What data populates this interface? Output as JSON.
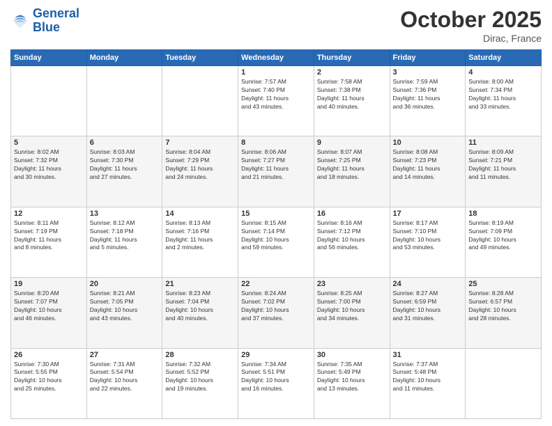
{
  "logo": {
    "line1": "General",
    "line2": "Blue"
  },
  "header": {
    "title": "October 2025",
    "location": "Dirac, France"
  },
  "days_of_week": [
    "Sunday",
    "Monday",
    "Tuesday",
    "Wednesday",
    "Thursday",
    "Friday",
    "Saturday"
  ],
  "weeks": [
    [
      {
        "day": "",
        "info": ""
      },
      {
        "day": "",
        "info": ""
      },
      {
        "day": "",
        "info": ""
      },
      {
        "day": "1",
        "info": "Sunrise: 7:57 AM\nSunset: 7:40 PM\nDaylight: 11 hours\nand 43 minutes."
      },
      {
        "day": "2",
        "info": "Sunrise: 7:58 AM\nSunset: 7:38 PM\nDaylight: 11 hours\nand 40 minutes."
      },
      {
        "day": "3",
        "info": "Sunrise: 7:59 AM\nSunset: 7:36 PM\nDaylight: 11 hours\nand 36 minutes."
      },
      {
        "day": "4",
        "info": "Sunrise: 8:00 AM\nSunset: 7:34 PM\nDaylight: 11 hours\nand 33 minutes."
      }
    ],
    [
      {
        "day": "5",
        "info": "Sunrise: 8:02 AM\nSunset: 7:32 PM\nDaylight: 11 hours\nand 30 minutes."
      },
      {
        "day": "6",
        "info": "Sunrise: 8:03 AM\nSunset: 7:30 PM\nDaylight: 11 hours\nand 27 minutes."
      },
      {
        "day": "7",
        "info": "Sunrise: 8:04 AM\nSunset: 7:29 PM\nDaylight: 11 hours\nand 24 minutes."
      },
      {
        "day": "8",
        "info": "Sunrise: 8:06 AM\nSunset: 7:27 PM\nDaylight: 11 hours\nand 21 minutes."
      },
      {
        "day": "9",
        "info": "Sunrise: 8:07 AM\nSunset: 7:25 PM\nDaylight: 11 hours\nand 18 minutes."
      },
      {
        "day": "10",
        "info": "Sunrise: 8:08 AM\nSunset: 7:23 PM\nDaylight: 11 hours\nand 14 minutes."
      },
      {
        "day": "11",
        "info": "Sunrise: 8:09 AM\nSunset: 7:21 PM\nDaylight: 11 hours\nand 11 minutes."
      }
    ],
    [
      {
        "day": "12",
        "info": "Sunrise: 8:11 AM\nSunset: 7:19 PM\nDaylight: 11 hours\nand 8 minutes."
      },
      {
        "day": "13",
        "info": "Sunrise: 8:12 AM\nSunset: 7:18 PM\nDaylight: 11 hours\nand 5 minutes."
      },
      {
        "day": "14",
        "info": "Sunrise: 8:13 AM\nSunset: 7:16 PM\nDaylight: 11 hours\nand 2 minutes."
      },
      {
        "day": "15",
        "info": "Sunrise: 8:15 AM\nSunset: 7:14 PM\nDaylight: 10 hours\nand 59 minutes."
      },
      {
        "day": "16",
        "info": "Sunrise: 8:16 AM\nSunset: 7:12 PM\nDaylight: 10 hours\nand 56 minutes."
      },
      {
        "day": "17",
        "info": "Sunrise: 8:17 AM\nSunset: 7:10 PM\nDaylight: 10 hours\nand 53 minutes."
      },
      {
        "day": "18",
        "info": "Sunrise: 8:19 AM\nSunset: 7:09 PM\nDaylight: 10 hours\nand 49 minutes."
      }
    ],
    [
      {
        "day": "19",
        "info": "Sunrise: 8:20 AM\nSunset: 7:07 PM\nDaylight: 10 hours\nand 46 minutes."
      },
      {
        "day": "20",
        "info": "Sunrise: 8:21 AM\nSunset: 7:05 PM\nDaylight: 10 hours\nand 43 minutes."
      },
      {
        "day": "21",
        "info": "Sunrise: 8:23 AM\nSunset: 7:04 PM\nDaylight: 10 hours\nand 40 minutes."
      },
      {
        "day": "22",
        "info": "Sunrise: 8:24 AM\nSunset: 7:02 PM\nDaylight: 10 hours\nand 37 minutes."
      },
      {
        "day": "23",
        "info": "Sunrise: 8:25 AM\nSunset: 7:00 PM\nDaylight: 10 hours\nand 34 minutes."
      },
      {
        "day": "24",
        "info": "Sunrise: 8:27 AM\nSunset: 6:59 PM\nDaylight: 10 hours\nand 31 minutes."
      },
      {
        "day": "25",
        "info": "Sunrise: 8:28 AM\nSunset: 6:57 PM\nDaylight: 10 hours\nand 28 minutes."
      }
    ],
    [
      {
        "day": "26",
        "info": "Sunrise: 7:30 AM\nSunset: 5:55 PM\nDaylight: 10 hours\nand 25 minutes."
      },
      {
        "day": "27",
        "info": "Sunrise: 7:31 AM\nSunset: 5:54 PM\nDaylight: 10 hours\nand 22 minutes."
      },
      {
        "day": "28",
        "info": "Sunrise: 7:32 AM\nSunset: 5:52 PM\nDaylight: 10 hours\nand 19 minutes."
      },
      {
        "day": "29",
        "info": "Sunrise: 7:34 AM\nSunset: 5:51 PM\nDaylight: 10 hours\nand 16 minutes."
      },
      {
        "day": "30",
        "info": "Sunrise: 7:35 AM\nSunset: 5:49 PM\nDaylight: 10 hours\nand 13 minutes."
      },
      {
        "day": "31",
        "info": "Sunrise: 7:37 AM\nSunset: 5:48 PM\nDaylight: 10 hours\nand 11 minutes."
      },
      {
        "day": "",
        "info": ""
      }
    ]
  ]
}
